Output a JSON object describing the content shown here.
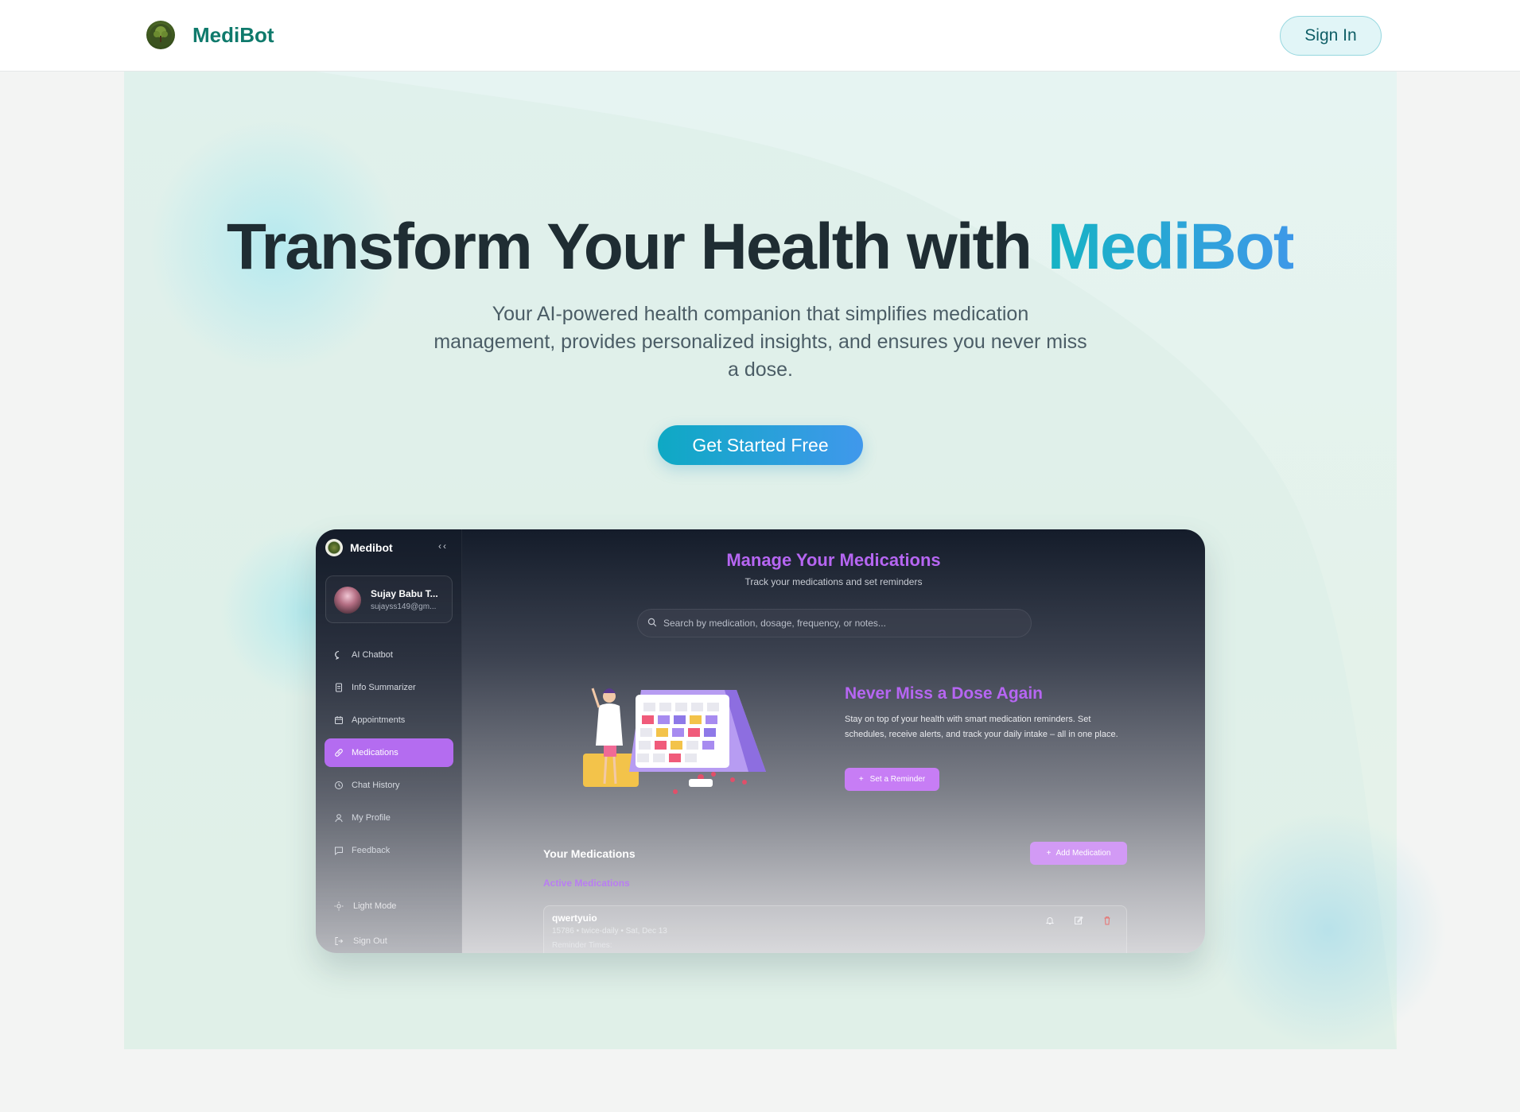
{
  "header": {
    "brand": "MediBot",
    "signin_label": "Sign In"
  },
  "hero": {
    "title_prefix": "Transform Your Health with",
    "title_accent": "MediBot",
    "subtitle": "Your AI-powered health companion that simplifies medication management, provides personalized insights, and ensures you never miss a dose.",
    "cta_label": "Get Started Free"
  },
  "preview": {
    "sidebar": {
      "title": "Medibot",
      "collapse_glyph": "‹‹",
      "user_name": "Sujay Babu T...",
      "user_email": "sujayss149@gm...",
      "items": [
        {
          "label": "AI Chatbot",
          "icon": "chat-icon"
        },
        {
          "label": "Info Summarizer",
          "icon": "document-icon"
        },
        {
          "label": "Appointments",
          "icon": "calendar-icon"
        },
        {
          "label": "Medications",
          "icon": "pill-icon",
          "active": true
        },
        {
          "label": "Chat History",
          "icon": "history-icon"
        },
        {
          "label": "My Profile",
          "icon": "user-icon"
        },
        {
          "label": "Feedback",
          "icon": "feedback-icon"
        }
      ],
      "light_mode": "Light Mode",
      "sign_out": "Sign Out"
    },
    "main": {
      "title": "Manage Your Medications",
      "subtitle": "Track your medications and set reminders",
      "search_placeholder": "Search by medication, dosage, frequency, or notes...",
      "promo_title": "Never Miss a Dose Again",
      "promo_text": "Stay on top of your health with smart medication reminders. Set schedules, receive alerts, and track your daily intake – all in one place.",
      "reminder_button": "Set a Reminder",
      "your_medications": "Your Medications",
      "add_medication": "Add Medication",
      "active_medications": "Active Medications",
      "card": {
        "name": "qwertyuio",
        "meta": "15786 • twice-daily • Sat, Dec 13",
        "reminder": "Reminder Times:"
      }
    }
  },
  "colors": {
    "brand_green": "#0f7a6c",
    "accent_gradient_start": "#16b3c4",
    "accent_gradient_end": "#3e98e8",
    "purple": "#b666f2"
  }
}
